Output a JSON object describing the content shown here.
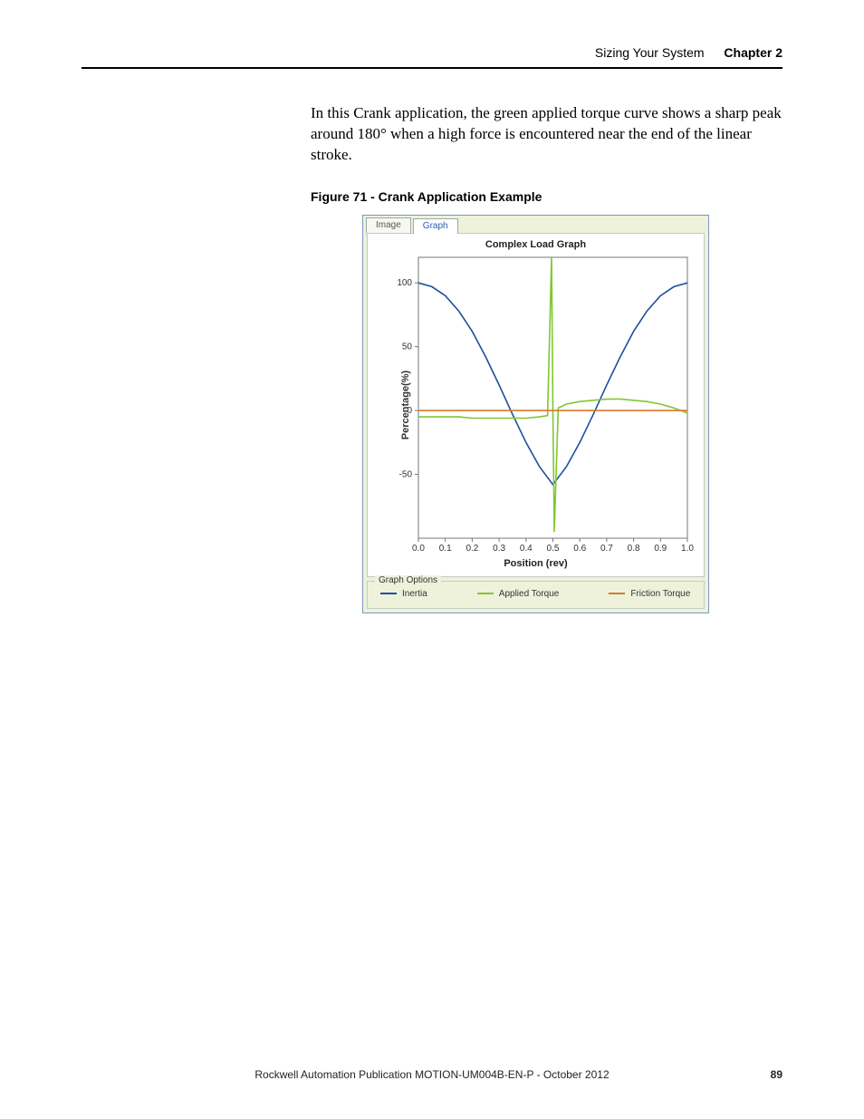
{
  "header": {
    "section": "Sizing Your System",
    "chapter": "Chapter 2"
  },
  "body_paragraph": "In this Crank application, the green applied torque curve shows a sharp peak around 180° when a high force is encountered near the end of the linear stroke.",
  "figure": {
    "caption": "Figure 71 - Crank Application Example",
    "tabs": {
      "image": "Image",
      "graph": "Graph"
    },
    "chart_title": "Complex Load Graph",
    "xlabel": "Position (rev)",
    "ylabel": "Percentage(%)",
    "options_label": "Graph Options",
    "legend": {
      "inertia": "Inertia",
      "applied": "Applied Torque",
      "friction": "Friction Torque"
    }
  },
  "footer": {
    "publication": "Rockwell Automation Publication MOTION-UM004B-EN-P - October 2012",
    "page": "89"
  },
  "chart_data": {
    "type": "line",
    "xlabel": "Position (rev)",
    "ylabel": "Percentage(%)",
    "xlim": [
      0.0,
      1.0
    ],
    "ylim": [
      -100,
      120
    ],
    "xticks": [
      0.0,
      0.1,
      0.2,
      0.3,
      0.4,
      0.5,
      0.6,
      0.7,
      0.8,
      0.9,
      1.0
    ],
    "yticks": [
      -50,
      0,
      50,
      100
    ],
    "title": "Complex Load Graph",
    "series": [
      {
        "name": "Inertia",
        "color": "#1c4fa0",
        "x": [
          0.0,
          0.05,
          0.1,
          0.15,
          0.2,
          0.25,
          0.3,
          0.35,
          0.4,
          0.45,
          0.5,
          0.55,
          0.6,
          0.65,
          0.7,
          0.75,
          0.8,
          0.85,
          0.9,
          0.95,
          1.0
        ],
        "y": [
          100,
          97,
          90,
          78,
          62,
          42,
          20,
          -3,
          -25,
          -44,
          -58,
          -44,
          -25,
          -3,
          20,
          42,
          62,
          78,
          90,
          97,
          100
        ]
      },
      {
        "name": "Applied Torque",
        "color": "#7fc731",
        "x": [
          0.0,
          0.05,
          0.1,
          0.15,
          0.2,
          0.25,
          0.3,
          0.35,
          0.4,
          0.45,
          0.48,
          0.495,
          0.5,
          0.505,
          0.52,
          0.55,
          0.6,
          0.65,
          0.7,
          0.75,
          0.8,
          0.85,
          0.9,
          0.95,
          1.0
        ],
        "y": [
          -5,
          -5,
          -5,
          -5,
          -6,
          -6,
          -6,
          -6,
          -6,
          -5,
          -4,
          120,
          0,
          -95,
          2,
          5,
          7,
          8,
          9,
          9,
          8,
          7,
          5,
          2,
          -2
        ]
      },
      {
        "name": "Friction Torque",
        "color": "#d97a2a",
        "x": [
          0.0,
          1.0
        ],
        "y": [
          0,
          0
        ]
      }
    ]
  }
}
